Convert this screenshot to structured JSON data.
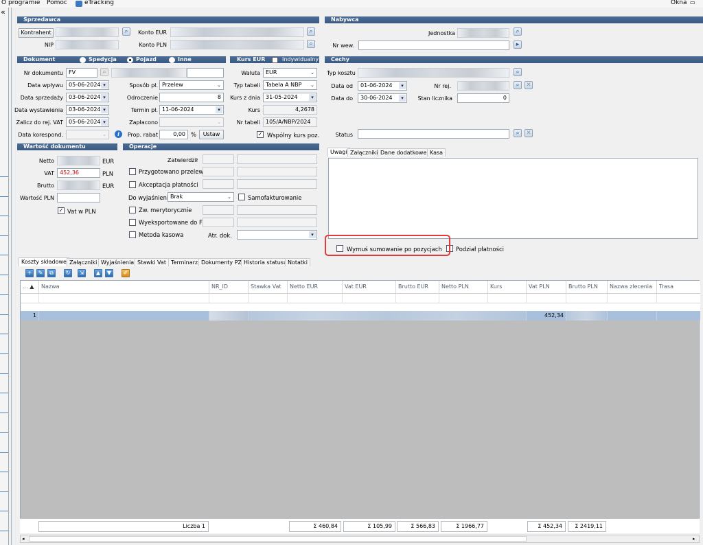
{
  "menu": {
    "items": [
      "O programie",
      "Pomoc",
      "eTracking"
    ],
    "right": "Okna"
  },
  "seller": {
    "title": "Sprzedawca",
    "contractor_btn": "Kontrahent",
    "nip": "NIP",
    "konto_eur": "Konto EUR",
    "konto_pln": "Konto PLN"
  },
  "buyer": {
    "title": "Nabywca",
    "unit": "Jednostka",
    "nr_wew": "Nr wew."
  },
  "document": {
    "title": "Dokument",
    "radios": [
      "Spedycja",
      "Pojazd",
      "Inne"
    ],
    "selected": "Pojazd",
    "nr_label": "Nr dokumentu",
    "nr_value": "FV",
    "data_wplywu_label": "Data wpływu",
    "data_wplywu": "05-06-2024",
    "data_sprzedazy_label": "Data sprzedaży",
    "data_sprzedazy": "03-06-2024",
    "data_wystawienia_label": "Data wystawienia",
    "data_wystawienia": "03-06-2024",
    "zalicz_label": "Zalicz do rej. VAT",
    "zalicz": "05-06-2024",
    "data_koresp_label": "Data korespond.",
    "sposob_label": "Sposób pł.",
    "sposob": "Przelew",
    "odroczenie_label": "Odroczenie",
    "odroczenie": "8",
    "termin_label": "Termin pł.",
    "termin": "11-06-2024",
    "zaplacono_label": "Zapłacono",
    "rabat_label": "Prop. rabat",
    "rabat": "0,00",
    "rabat_unit": "%",
    "ustaw": "Ustaw"
  },
  "kurs": {
    "title": "Kurs EUR",
    "indywidualny": "Indywidualny",
    "waluta_label": "Waluta",
    "waluta": "EUR",
    "typ_tabeli_label": "Typ tabeli",
    "typ_tabeli": "Tabela A NBP",
    "kurs_z_dnia_label": "Kurs z dnia",
    "kurs_z_dnia": "31-05-2024",
    "kurs_label": "Kurs",
    "kurs": "4,2678",
    "nr_tabeli_label": "Nr tabeli",
    "nr_tabeli": "105/A/NBP/2024",
    "wspolny": "Wspólny kurs poz."
  },
  "cechy": {
    "title": "Cechy",
    "typ_kosztu": "Typ kosztu",
    "data_od_label": "Data od",
    "data_od": "01-06-2024",
    "data_do_label": "Data do",
    "data_do": "30-06-2024",
    "nr_rej": "Nr rej.",
    "stan_licznika": "Stan licznika",
    "stan_value": "0",
    "status": "Status"
  },
  "wartosc": {
    "title": "Wartość dokumentu",
    "netto": "Netto",
    "vat": "VAT",
    "vat_value": "452,36",
    "brutto": "Brutto",
    "wartosc_pln": "Wartość PLN",
    "cur_eur": "EUR",
    "cur_pln": "PLN",
    "vat_w_pln": "Vat w PLN"
  },
  "operacje": {
    "title": "Operacje",
    "zatwierdzil": "Zatwierdził",
    "przygotowano": "Przygotowano przelew",
    "akceptacja": "Akceptacja płatności",
    "do_wyjasnienia_label": "Do wyjaśnienia",
    "do_wyjasnienia": "Brak",
    "samofakturowanie": "Samofakturowanie",
    "zw_merytorycznie": "Zw. merytorycznie",
    "wyeksportowane": "Wyeksportowane do FK",
    "metoda_kasowa": "Metoda kasowa",
    "atr_dok": "Atr. dok."
  },
  "notes_tabs": [
    "Uwagi",
    "Załączniki",
    "Dane dodatkowe",
    "Kasa"
  ],
  "wymus": "Wymuś sumowanie po pozycjach",
  "podzial": "Podział płatności",
  "bottom_tabs": [
    "Koszty składowe",
    "Załączniki",
    "Wyjaśnienia",
    "Stawki Vat",
    "Terminarz",
    "Dokumenty PZ",
    "Historia statusu",
    "Notatki"
  ],
  "grid": {
    "columns": [
      "Nazwa",
      "NR_ID",
      "Stawka Vat",
      "Netto EUR",
      "Vat EUR",
      "Brutto EUR",
      "Netto PLN",
      "Kurs",
      "Vat PLN",
      "Brutto PLN",
      "Nazwa zlecenia",
      "Trasa"
    ],
    "sort_indicator": "...",
    "row": {
      "index": "1",
      "vat_pln": "452,34"
    },
    "footer": {
      "liczba": "Liczba 1",
      "netto_eur": "Σ 460,84",
      "vat_eur": "Σ 105,99",
      "brutto_eur": "Σ 566,83",
      "netto_pln": "Σ 1966,77",
      "vat_pln": "Σ 452,34",
      "brutto_pln": "Σ 2419,11"
    }
  },
  "colors": {
    "header": "#3f618a",
    "selected_row": "#a9c0dc",
    "highlight": "#e03a3a"
  }
}
